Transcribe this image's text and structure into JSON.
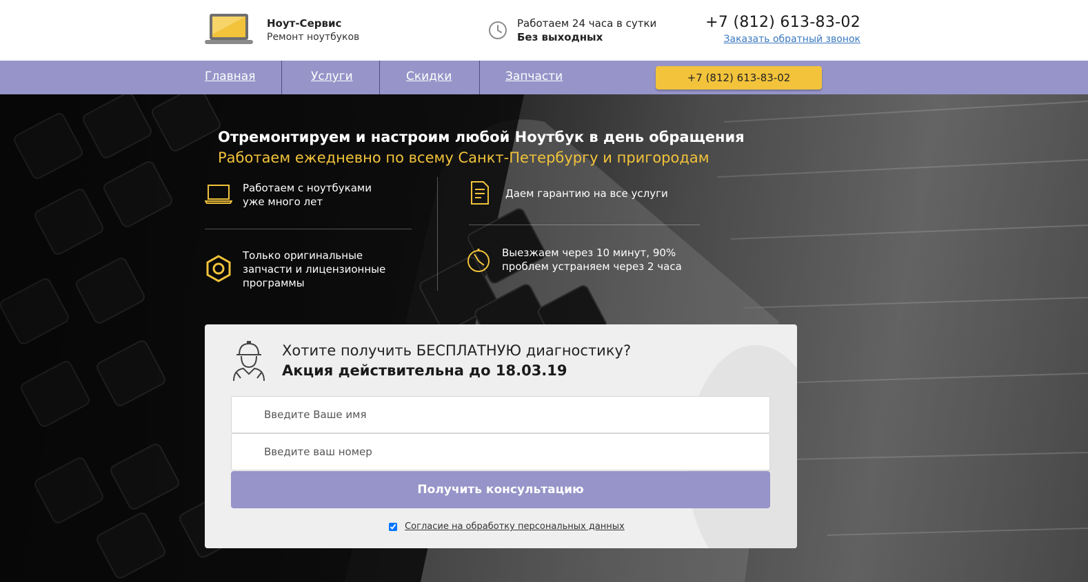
{
  "header": {
    "brand_name": "Ноут-Сервис",
    "brand_tagline": "Ремонт ноутбуков",
    "hours_line1": "Работаем 24 часа в сутки",
    "hours_line2": "Без выходных",
    "phone": "+7 (812) 613-83-02",
    "callback_link": "Заказать обратный звонок"
  },
  "nav": {
    "items": [
      {
        "label": "Главная"
      },
      {
        "label": "Услуги"
      },
      {
        "label": "Скидки"
      },
      {
        "label": "Запчасти"
      }
    ],
    "phone_button": "+7 (812) 613-83-02"
  },
  "hero": {
    "title": "Отремонтируем и настроим любой Ноутбук в день обращения",
    "subtitle": "Работаем ежедневно по всему Санкт-Петербургу и пригородам",
    "features": [
      {
        "icon": "laptop-icon",
        "line1": "Работаем с ноутбуками",
        "line2": "уже много лет",
        "line3": ""
      },
      {
        "icon": "document-icon",
        "line1": "Даем гарантию на все услуги",
        "line2": "",
        "line3": ""
      },
      {
        "icon": "hex-nut-icon",
        "line1": "Только оригинальные",
        "line2": "запчасти и лицензионные",
        "line3": "программы"
      },
      {
        "icon": "stopwatch-icon",
        "line1": "Выезжаем через 10 минут, 90%",
        "line2": "проблем устраняем через 2 часа",
        "line3": ""
      }
    ]
  },
  "form": {
    "question": "Хотите получить БЕСПЛАТНУЮ диагностику?",
    "promo": "Акция действительна до 18.03.19",
    "name_placeholder": "Введите Ваше имя",
    "phone_placeholder": "Введите ваш номер",
    "submit_label": "Получить консультацию",
    "consent_label": "Согласие на обработку персональных данных",
    "consent_checked": true
  },
  "colors": {
    "accent_yellow": "#f2c33b",
    "nav_purple": "#9694c8",
    "link_blue": "#3a79c0"
  }
}
